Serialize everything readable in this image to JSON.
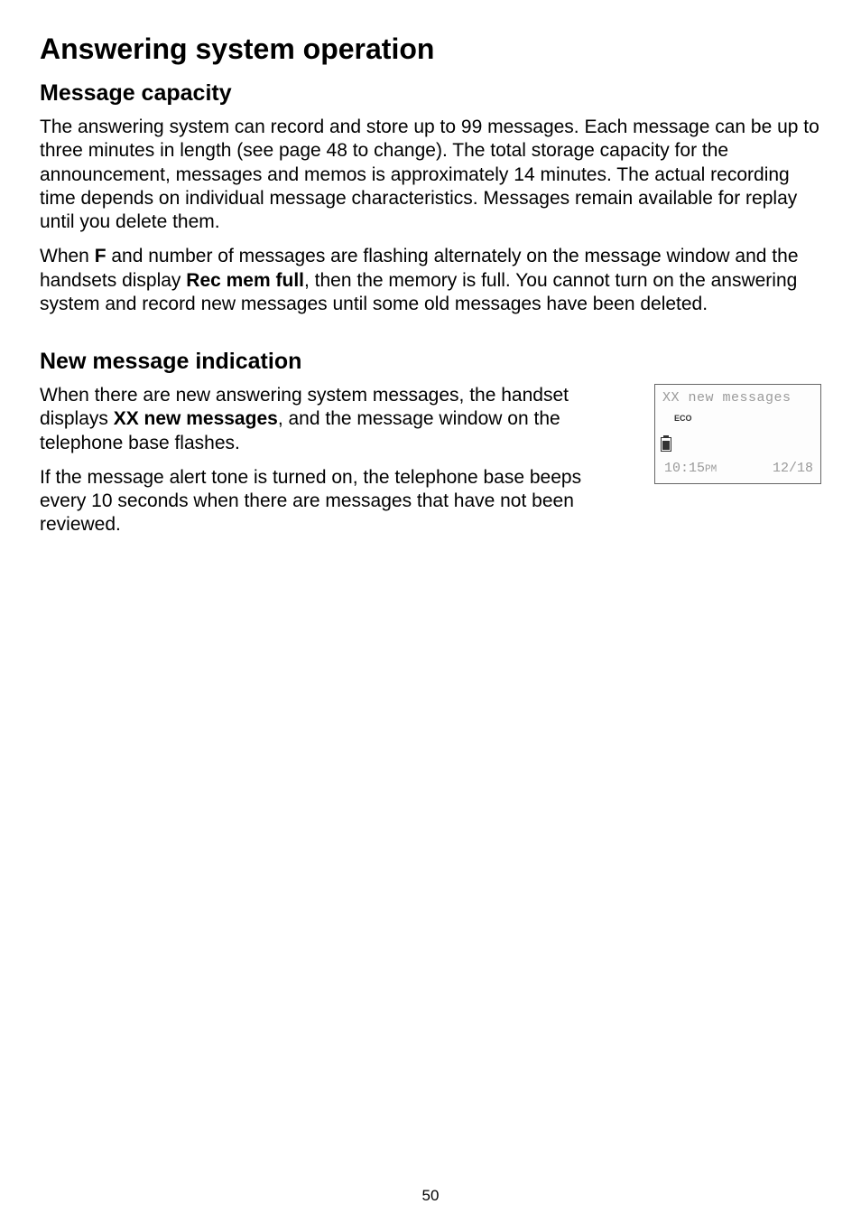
{
  "page": {
    "title": "Answering system operation",
    "number": "50"
  },
  "section1": {
    "heading": "Message capacity",
    "para1": "The answering system can record and store up to 99 messages. Each message can be up to three minutes in length (see page 48 to change). The total storage capacity for the announcement, messages and memos is approximately 14 minutes. The actual recording time depends on individual message characteristics. Messages remain available for replay until you delete them.",
    "para2_pre": "When ",
    "para2_bold1": "F",
    "para2_mid": " and number of messages are flashing alternately on the message window and the handsets display ",
    "para2_bold2": "Rec mem full",
    "para2_post": ", then the memory is full. You cannot turn on the answering system and record new messages until some old messages have been deleted."
  },
  "section2": {
    "heading": "New message indication",
    "para1_pre": "When there are new answering system messages, the handset displays ",
    "para1_bold": "XX new messages",
    "para1_post": ", and the message window on the telephone base flashes.",
    "para2": "If the message alert tone is turned on, the telephone base beeps every 10 seconds when there are messages that have not been reviewed."
  },
  "display": {
    "line1": "XX new messages",
    "eco": "ECO",
    "time": "10:15",
    "time_suffix": "PM",
    "date": "12/18"
  }
}
